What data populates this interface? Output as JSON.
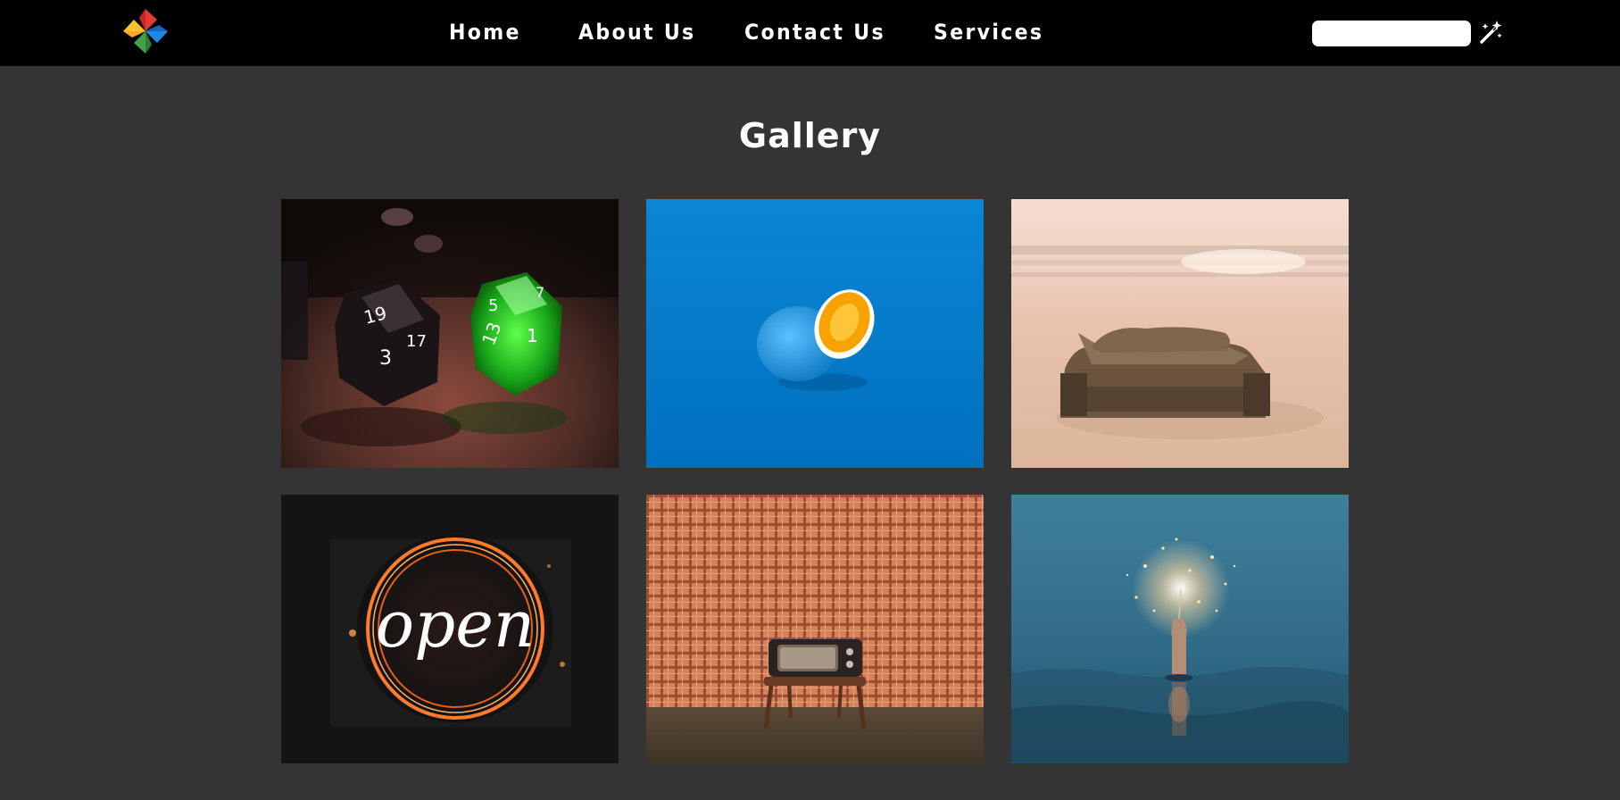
{
  "nav": {
    "links": [
      {
        "label": "Home"
      },
      {
        "label": "About Us"
      },
      {
        "label": "Contact Us"
      },
      {
        "label": "Services"
      }
    ],
    "search": {
      "value": "",
      "placeholder": ""
    },
    "icons": {
      "logo": "pinwheel-logo-icon",
      "search": "magic-wand-icon"
    }
  },
  "gallery": {
    "title": "Gallery",
    "images": [
      {
        "name": "dice-photo",
        "sign_text": ""
      },
      {
        "name": "blue-orange-photo",
        "sign_text": ""
      },
      {
        "name": "beach-sofa-photo",
        "sign_text": ""
      },
      {
        "name": "neon-open-sign-photo",
        "sign_text": "open"
      },
      {
        "name": "retro-tv-photo",
        "sign_text": ""
      },
      {
        "name": "sparkler-sea-photo",
        "sign_text": ""
      }
    ]
  },
  "colors": {
    "page_background": "#343434",
    "navbar_background": "#000000",
    "text": "#ffffff"
  }
}
